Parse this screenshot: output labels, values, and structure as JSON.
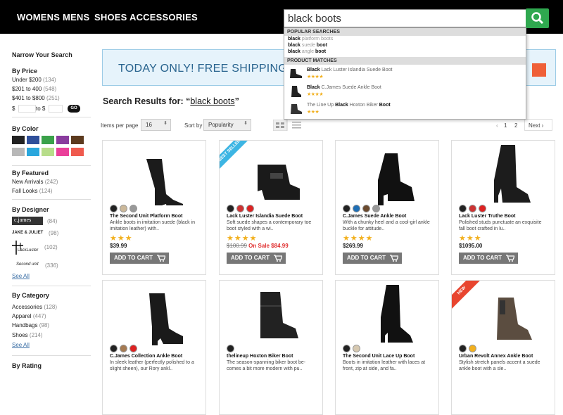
{
  "nav": {
    "items": [
      "WOMENS",
      "MENS",
      "SHOES",
      "ACCESSORIES"
    ]
  },
  "search": {
    "value": "black boots",
    "popular_header": "POPULAR SEARCHES",
    "popular": [
      {
        "bold": "black",
        "rest": " platform boots"
      },
      {
        "bold": "black",
        "rest": " suede ",
        "bold2": "boot"
      },
      {
        "bold": "black",
        "rest": " angle ",
        "bold2": "boot"
      }
    ],
    "matches_header": "PRODUCT MATCHES",
    "matches": [
      {
        "pre": "",
        "bold": "Black",
        "rest": " Lack Luster Islandia Suede Boot",
        "stars": "★★★★"
      },
      {
        "pre": "",
        "bold": "Black",
        "rest": " C.James Suede Ankle Boot",
        "stars": "★★★★"
      },
      {
        "pre": "The Line Up ",
        "bold": "Black",
        "rest": " Hoxton Biker ",
        "bold2": "Boot",
        "stars": "★★★"
      }
    ]
  },
  "sidebar": {
    "title": "Narrow Your Search",
    "price": {
      "title": "By Price",
      "items": [
        {
          "label": "Under $200",
          "count": "(134)"
        },
        {
          "label": "$201 to 400",
          "count": "(548)"
        },
        {
          "label": "$401 to $800",
          "count": "(251)"
        }
      ],
      "from": "$",
      "to": "to $",
      "go": "GO"
    },
    "color": {
      "title": "By Color",
      "swatches": [
        "#222222",
        "#2f4f9a",
        "#3aa14a",
        "#8a3c9e",
        "#5c3a1e",
        "#b8b8b8",
        "#2aa7dd",
        "#b7dd8a",
        "#ea3f9a",
        "#ef5a4e"
      ]
    },
    "featured": {
      "title": "By Featured",
      "items": [
        {
          "label": "New Arrivals",
          "count": "(242)"
        },
        {
          "label": "Fall Looks",
          "count": "(124)"
        }
      ]
    },
    "designer": {
      "title": "By Designer",
      "items": [
        {
          "label": "c.james",
          "count": "(84)"
        },
        {
          "label": "JAKE & JULIET",
          "count": "(98)"
        },
        {
          "label": "LackLuster",
          "count": "(102)"
        },
        {
          "label": "Second unit",
          "count": "(336)"
        }
      ],
      "see_all": "See All"
    },
    "category": {
      "title": "By Category",
      "items": [
        {
          "label": "Accessories",
          "count": "(128)"
        },
        {
          "label": "Apparel",
          "count": "(447)"
        },
        {
          "label": "Handbags",
          "count": "(98)"
        },
        {
          "label": "Shoes",
          "count": "(214)"
        }
      ],
      "see_all": "See All"
    },
    "rating": {
      "title": "By Rating"
    }
  },
  "banner": {
    "text": "TODAY ONLY! FREE SHIPPING O"
  },
  "results": {
    "label": "Search Results for: “",
    "query": "black boots",
    "close": "”"
  },
  "toolbar": {
    "ipp_label": "Items per page",
    "ipp": "16",
    "sort_label": "Sort by",
    "sort": "Popularity",
    "pages": [
      "‹",
      "1",
      "2",
      "3"
    ],
    "next": "Next ›"
  },
  "products": [
    {
      "name": "The Second Unit Platform Boot",
      "desc": "Ankle boots in imitation suede (black in imitation leather) with..",
      "stars": "★★★",
      "price": "$39.99",
      "old": "",
      "sale": "",
      "colors": [
        "#222",
        "#cbb89a",
        "#999"
      ],
      "btn": "ADD TO CART",
      "ribbon": "",
      "ribbon_color": ""
    },
    {
      "name": "Lack Luster Islandia Suede Boot",
      "desc": "Soft suede shapes a contemporary toe boot styled with a wi..",
      "stars": "★★★★",
      "price": "",
      "old": "$100.99",
      "sale": "On Sale $84.99",
      "colors": [
        "#222",
        "#c33",
        "#d22"
      ],
      "btn": "ADD TO CART",
      "ribbon": "BEST SELLER",
      "ribbon_color": "#3db5e3"
    },
    {
      "name": "C.James Suede Ankle Boot",
      "desc": "With a chunky heel and a cool-girl ankle buckle for attitude..",
      "stars": "★★★★",
      "price": "$269.99",
      "old": "",
      "sale": "",
      "colors": [
        "#222",
        "#1f6fb5",
        "#6b4a2e",
        "#999"
      ],
      "btn": "ADD TO CART",
      "ribbon": "",
      "ribbon_color": ""
    },
    {
      "name": "Lack Luster Truthe Boot",
      "desc": "Polished studs punctuate an exquisite fall boot crafted in lu..",
      "stars": "★★★",
      "price": "$1095.00",
      "old": "",
      "sale": "",
      "colors": [
        "#222",
        "#c33",
        "#d22"
      ],
      "btn": "ADD TO CART",
      "ribbon": "",
      "ribbon_color": ""
    },
    {
      "name": "C.James Collection Ankle Boot",
      "desc": "In sleek leather (perfectly polished to a slight sheen), our Rory ankl..",
      "stars": "",
      "price": "",
      "old": "",
      "sale": "",
      "colors": [
        "#222",
        "#a57a52",
        "#d22"
      ],
      "btn": "",
      "ribbon": "",
      "ribbon_color": ""
    },
    {
      "name": "thelineup Hoxton Biker Boot",
      "desc": "The season-spanning biker boot be-comes a bit more modern with pu..",
      "stars": "",
      "price": "",
      "old": "",
      "sale": "",
      "colors": [
        "#222"
      ],
      "btn": "",
      "ribbon": "",
      "ribbon_color": ""
    },
    {
      "name": "The Second Unit Lace Up Boot",
      "desc": "Boots in imitation leather with laces at front, zip at side, and fa..",
      "stars": "",
      "price": "",
      "old": "",
      "sale": "",
      "colors": [
        "#222",
        "#d6c8b0"
      ],
      "btn": "",
      "ribbon": "",
      "ribbon_color": ""
    },
    {
      "name": "Urban Revolt Annex Ankle Boot",
      "desc": "Stylish stretch panels accent a suede ankle boot with a sle..",
      "stars": "",
      "price": "",
      "old": "",
      "sale": "",
      "colors": [
        "#222",
        "#f2b01e"
      ],
      "btn": "",
      "ribbon": "NEW",
      "ribbon_color": "#e8452f"
    }
  ]
}
